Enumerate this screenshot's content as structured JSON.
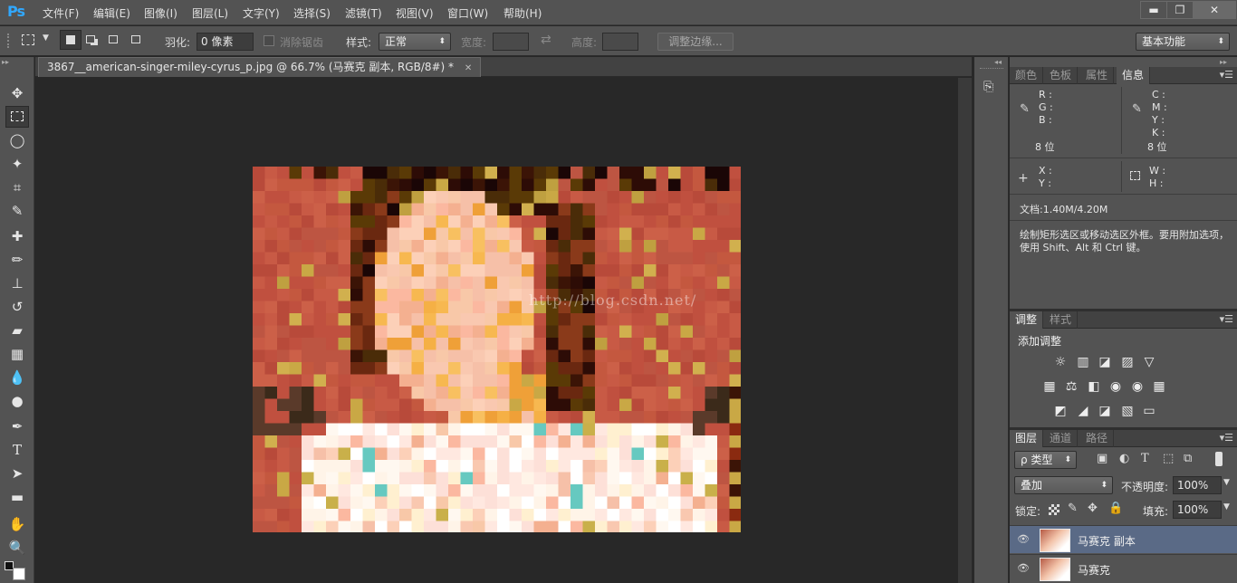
{
  "app": {
    "logo": "Ps"
  },
  "menu": [
    "文件(F)",
    "编辑(E)",
    "图像(I)",
    "图层(L)",
    "文字(Y)",
    "选择(S)",
    "滤镜(T)",
    "视图(V)",
    "窗口(W)",
    "帮助(H)"
  ],
  "window_controls": {
    "minimize": "▬",
    "restore": "❐",
    "close": "✕"
  },
  "options": {
    "feather_label": "羽化:",
    "feather_value": "0 像素",
    "antialias_label": "消除锯齿",
    "style_label": "样式:",
    "style_value": "正常",
    "width_label": "宽度:",
    "height_label": "高度:",
    "refine_edge": "调整边缘...",
    "workspace": "基本功能"
  },
  "document": {
    "tab_title": "3867__american-singer-miley-cyrus_p.jpg @ 66.7% (马赛克 副本, RGB/8#) *",
    "watermark": "http://blog.csdn.net/"
  },
  "info_panel": {
    "tabs": [
      "颜色",
      "色板",
      "属性",
      "信息"
    ],
    "active_tab": "信息",
    "rgb": "R :\nG :\nB :",
    "cmyk": "C :\nM :\nY :\nK :",
    "bits_left": "8 位",
    "bits_right": "8 位",
    "xy": "X :\nY :",
    "wh": "W :\nH :",
    "doc_size": "文档:1.40M/4.20M",
    "hint": "绘制矩形选区或移动选区外框。要用附加选项，使用 Shift、Alt 和 Ctrl 键。"
  },
  "adjust_panel": {
    "tabs": [
      "调整",
      "样式"
    ],
    "title": "添加调整",
    "row1": [
      "☼",
      "▥",
      "◪",
      "▨",
      "▽"
    ],
    "row2": [
      "▦",
      "⚖",
      "◧",
      "◉",
      "▦"
    ],
    "row3": [
      "◩",
      "◢",
      "◪",
      "▧",
      "▭"
    ]
  },
  "layers_panel": {
    "tabs": [
      "图层",
      "通道",
      "路径"
    ],
    "filter_kind": "ρ 类型",
    "blend_mode": "叠加",
    "opacity_label": "不透明度:",
    "opacity_value": "100%",
    "lock_label": "锁定:",
    "fill_label": "填充:",
    "fill_value": "100%",
    "layers": [
      {
        "name": "马赛克 副本",
        "selected": true
      },
      {
        "name": "马赛克",
        "selected": false
      }
    ]
  },
  "colors": {
    "accent": "#31a8ff",
    "ui_bg": "#535353",
    "canvas_bg": "#282828",
    "selected_layer": "#5a6a86"
  }
}
